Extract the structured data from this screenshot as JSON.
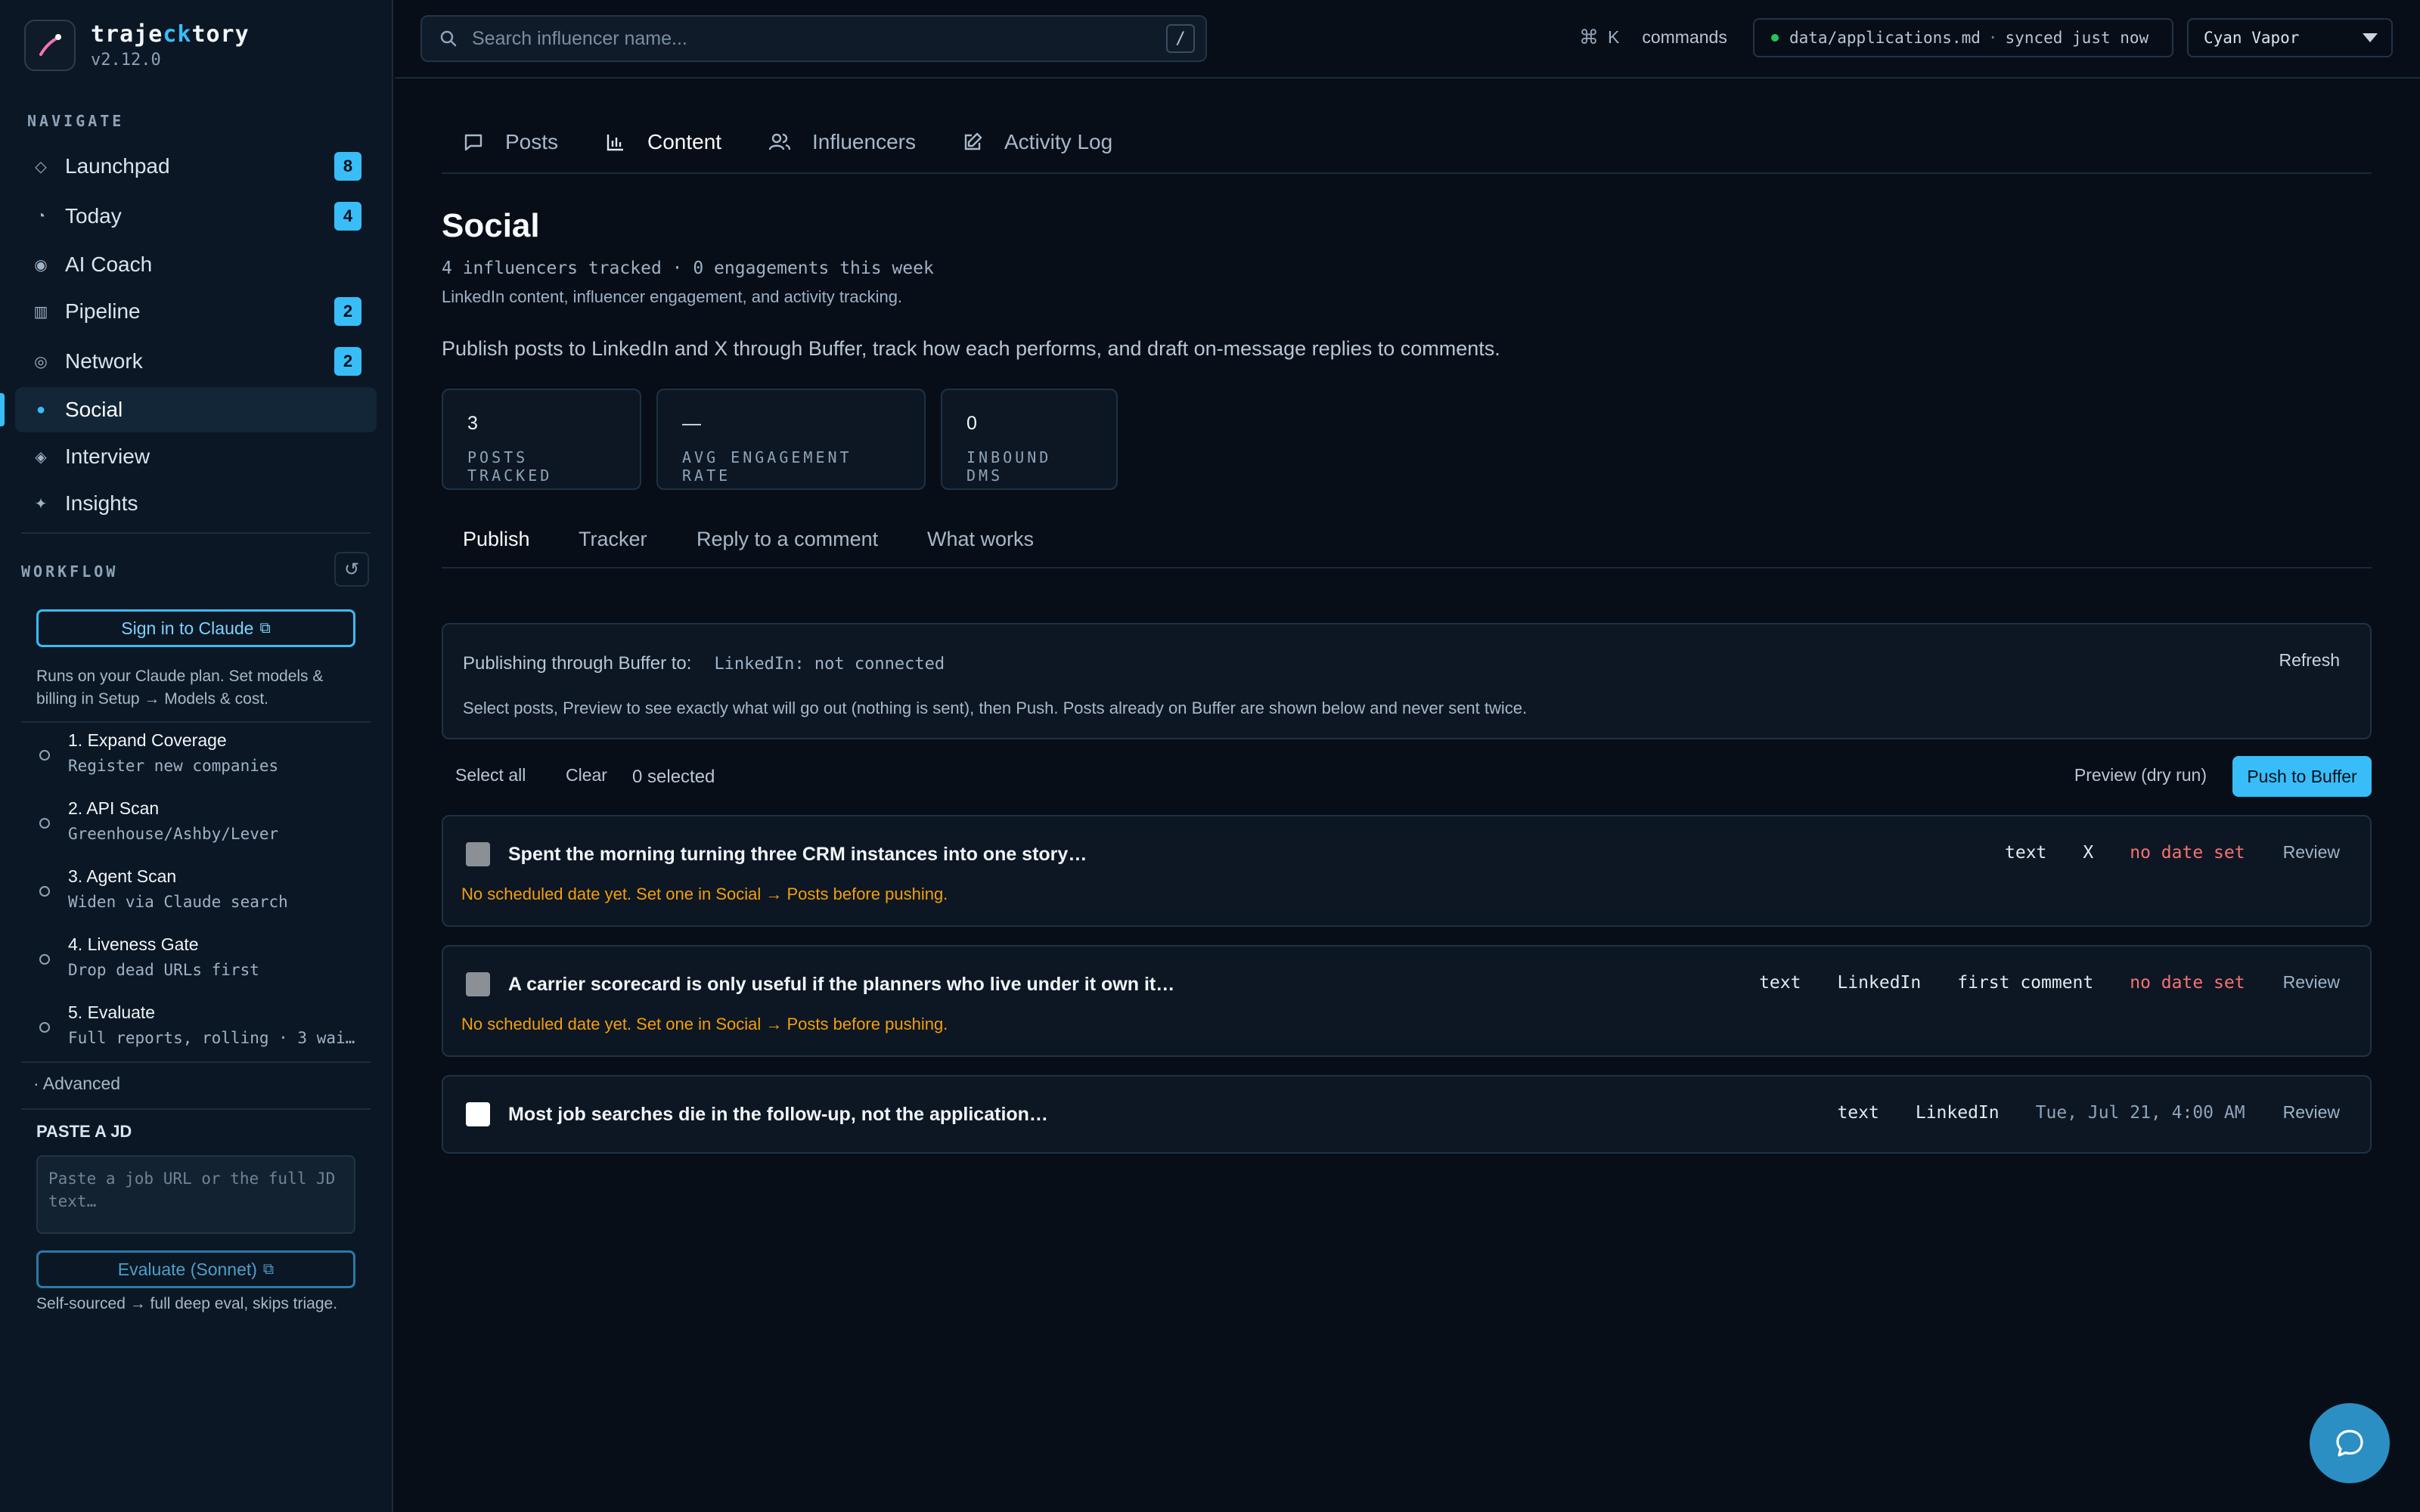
{
  "app": {
    "name_prefix": "traje",
    "name_highlight": "ck",
    "name_suffix": "tory",
    "version": "v2.12.0"
  },
  "sidebar": {
    "navigate_label": "NAVIGATE",
    "items": [
      {
        "label": "Launchpad",
        "icon": "diamond-outline-icon",
        "badge": "8"
      },
      {
        "label": "Today",
        "icon": "clock-icon",
        "badge": "4"
      },
      {
        "label": "AI Coach",
        "icon": "target-icon",
        "badge": ""
      },
      {
        "label": "Pipeline",
        "icon": "columns-icon",
        "badge": "2"
      },
      {
        "label": "Network",
        "icon": "ring-icon",
        "badge": "2"
      },
      {
        "label": "Social",
        "icon": "dot-icon",
        "badge": ""
      },
      {
        "label": "Interview",
        "icon": "diamond-icon",
        "badge": ""
      },
      {
        "label": "Insights",
        "icon": "sparkle-icon",
        "badge": ""
      }
    ],
    "workflow_label": "WORKFLOW",
    "sign_in_label": "Sign in to Claude",
    "plan_note": "Runs on your Claude plan. Set models & billing in Setup → Models & cost.",
    "steps": [
      {
        "title": "1. Expand Coverage",
        "sub": "Register new companies"
      },
      {
        "title": "2. API Scan",
        "sub": "Greenhouse/Ashby/Lever"
      },
      {
        "title": "3. Agent Scan",
        "sub": "Widen via Claude search"
      },
      {
        "title": "4. Liveness Gate",
        "sub": "Drop dead URLs first"
      },
      {
        "title": "5. Evaluate",
        "sub": "Full reports, rolling · 3 wai…"
      }
    ],
    "advanced_label": "Advanced",
    "jd_label": "PASTE A JD",
    "jd_placeholder": "Paste a job URL or the full JD text…",
    "evaluate_label": "Evaluate (Sonnet)",
    "evaluate_note": "Self-sourced → full deep eval, skips triage."
  },
  "topbar": {
    "search_placeholder": "Search influencer name...",
    "search_kbd": "/",
    "cmd_symbol": "⌘",
    "cmd_key": "K",
    "cmd_word": "commands",
    "sync_file": "data/applications.md",
    "sync_sep": "·",
    "sync_status": "synced just now",
    "theme": "Cyan Vapor"
  },
  "main": {
    "tabs": [
      {
        "label": "Posts",
        "icon": "comment-icon"
      },
      {
        "label": "Content",
        "icon": "bar-chart-icon"
      },
      {
        "label": "Influencers",
        "icon": "users-icon"
      },
      {
        "label": "Activity Log",
        "icon": "edit-icon"
      }
    ],
    "title": "Social",
    "meta1": "4 influencers tracked · 0 engagements this week",
    "meta2": "LinkedIn content, influencer engagement, and activity tracking.",
    "lead": "Publish posts to LinkedIn and X through Buffer, track how each performs, and draft on-message replies to comments.",
    "stats": [
      {
        "value": "3",
        "label": "POSTS TRACKED"
      },
      {
        "value": "—",
        "label": "AVG ENGAGEMENT RATE"
      },
      {
        "value": "0",
        "label": "INBOUND DMS"
      }
    ],
    "sub_tabs": [
      "Publish",
      "Tracker",
      "Reply to a comment",
      "What works"
    ],
    "buffer": {
      "label": "Publishing through Buffer to:",
      "connection": "LinkedIn: not connected",
      "refresh": "Refresh",
      "note": "Select posts, Preview to see exactly what will go out (nothing is sent), then Push. Posts already on Buffer are shown below and never sent twice."
    },
    "toolbar": {
      "select_all": "Select all",
      "clear": "Clear",
      "selected": "0 selected",
      "preview": "Preview (dry run)",
      "push": "Push to Buffer"
    },
    "posts": [
      {
        "title": "Spent the morning turning three CRM instances into one story…",
        "type": "text",
        "platform": "X",
        "extra": "",
        "date": "no date set",
        "review": "Review",
        "warning": "No scheduled date yet. Set one in Social → Posts before pushing."
      },
      {
        "title": "A carrier scorecard is only useful if the planners who live under it own it…",
        "type": "text",
        "platform": "LinkedIn",
        "extra": "first comment",
        "date": "no date set",
        "review": "Review",
        "warning": "No scheduled date yet. Set one in Social → Posts before pushing."
      },
      {
        "title": "Most job searches die in the follow-up, not the application…",
        "type": "text",
        "platform": "LinkedIn",
        "extra": "",
        "date": "Tue, Jul 21, 4:00 AM",
        "review": "Review",
        "warning": ""
      }
    ]
  },
  "colors": {
    "accent": "#38bdf8",
    "background": "#070e17",
    "sidebar": "#0b1724",
    "warning": "#f59e0b",
    "danger": "#f87171",
    "sync_dot": "#22c55e"
  }
}
